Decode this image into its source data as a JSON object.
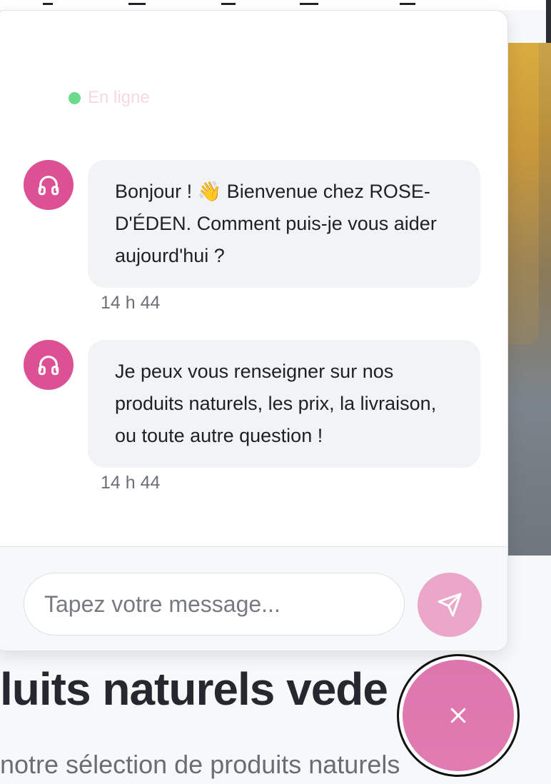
{
  "chat": {
    "status_label": "En ligne",
    "messages": [
      {
        "text": "Bonjour ! 👋 Bienvenue chez ROSE-D'ÉDEN. Comment puis-je vous aider aujourd'hui ?",
        "time": "14 h 44",
        "avatar_icon": "headphones-icon"
      },
      {
        "text": "Je peux vous renseigner sur nos produits naturels, les prix, la livraison, ou toute autre question !",
        "time": "14 h 44",
        "avatar_icon": "headphones-icon"
      }
    ],
    "input_placeholder": "Tapez votre message...",
    "send_icon": "send-icon",
    "close_icon": "close-icon"
  },
  "page": {
    "section_title": "luits naturels vede",
    "section_subtitle": "notre sélection de produits naturels"
  },
  "colors": {
    "accent": "#db5193",
    "send_button": "#eaa7c9",
    "fab": "#e07cb1",
    "online_dot": "#6dd98a",
    "bubble": "#f2f3f5"
  }
}
